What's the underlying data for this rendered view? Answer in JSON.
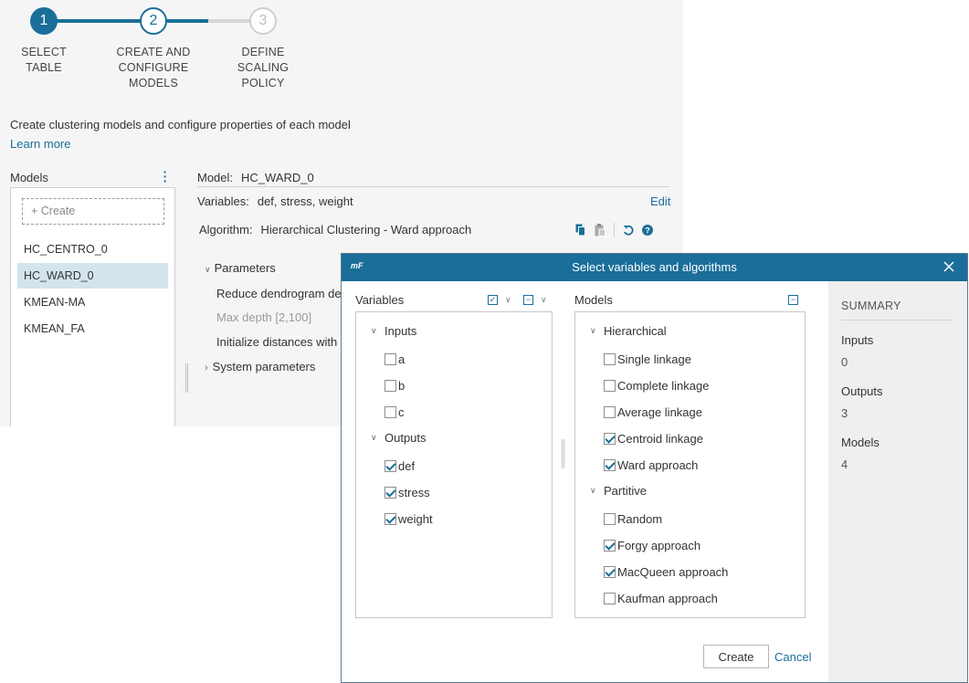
{
  "stepper": {
    "steps": [
      {
        "number": "1",
        "label_lines": [
          "SELECT",
          "TABLE"
        ],
        "state": "done"
      },
      {
        "number": "2",
        "label_lines": [
          "CREATE AND",
          "CONFIGURE",
          "MODELS"
        ],
        "state": "current"
      },
      {
        "number": "3",
        "label_lines": [
          "DEFINE",
          "SCALING",
          "POLICY"
        ],
        "state": "future"
      }
    ]
  },
  "page": {
    "description": "Create clustering models and configure properties of each model",
    "learn_more": "Learn more"
  },
  "models_panel": {
    "title": "Models",
    "create_label": "+ Create",
    "items": [
      "HC_CENTRO_0",
      "HC_WARD_0",
      "KMEAN-MA",
      "KMEAN_FA"
    ],
    "selected": "HC_WARD_0"
  },
  "model_detail": {
    "model_key": "Model:",
    "model_value": "HC_WARD_0",
    "variables_key": "Variables:",
    "variables_value": "def, stress, weight",
    "edit_label": "Edit",
    "algorithm_key": "Algorithm:",
    "algorithm_value": "Hierarchical Clustering - Ward approach",
    "parameters_label": "Parameters",
    "param_rows": [
      "Reduce dendrogram dep",
      "Max depth [2,100]",
      "Initialize distances with"
    ],
    "system_parameters_label": "System parameters"
  },
  "dialog": {
    "logo": "mF",
    "title": "Select variables and algorithms",
    "variables": {
      "title": "Variables",
      "groups": [
        {
          "label": "Inputs",
          "items": [
            {
              "label": "a",
              "checked": false
            },
            {
              "label": "b",
              "checked": false
            },
            {
              "label": "c",
              "checked": false
            }
          ]
        },
        {
          "label": "Outputs",
          "items": [
            {
              "label": "def",
              "checked": true
            },
            {
              "label": "stress",
              "checked": true
            },
            {
              "label": "weight",
              "checked": true
            }
          ]
        }
      ]
    },
    "models": {
      "title": "Models",
      "groups": [
        {
          "label": "Hierarchical",
          "items": [
            {
              "label": "Single linkage",
              "checked": false
            },
            {
              "label": "Complete linkage",
              "checked": false
            },
            {
              "label": "Average linkage",
              "checked": false
            },
            {
              "label": "Centroid linkage",
              "checked": true
            },
            {
              "label": "Ward approach",
              "checked": true
            }
          ]
        },
        {
          "label": "Partitive",
          "items": [
            {
              "label": "Random",
              "checked": false
            },
            {
              "label": "Forgy approach",
              "checked": true
            },
            {
              "label": "MacQueen approach",
              "checked": true
            },
            {
              "label": "Kaufman approach",
              "checked": false
            }
          ]
        }
      ]
    },
    "summary": {
      "title": "SUMMARY",
      "inputs_label": "Inputs",
      "inputs_value": "0",
      "outputs_label": "Outputs",
      "outputs_value": "3",
      "models_label": "Models",
      "models_value": "4"
    },
    "create_button": "Create",
    "cancel_button": "Cancel"
  },
  "colors": {
    "accent": "#1a6e99",
    "selected_row": "#d3e4ed",
    "summary_bg": "#efefef",
    "page_bg": "#f5f5f5"
  }
}
